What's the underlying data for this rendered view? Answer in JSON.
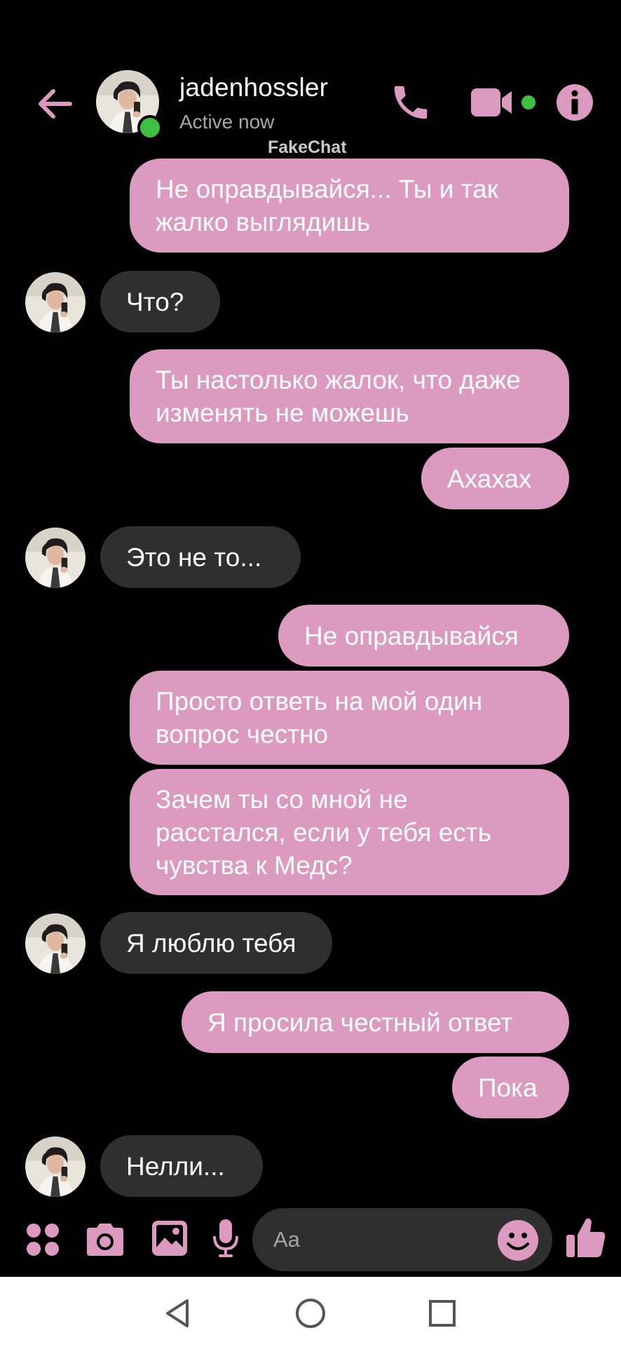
{
  "header": {
    "contact_name": "jadenhossler",
    "status": "Active now",
    "watermark": "FakeChat"
  },
  "messages": [
    {
      "side": "outgoing",
      "text": "Не оправдывайся... Ты и так жалко выглядишь"
    },
    {
      "side": "incoming",
      "text": "Что?"
    },
    {
      "side": "outgoing",
      "text": "Ты настолько жалок, что даже изменять не можешь"
    },
    {
      "side": "outgoing",
      "text": "Ахахах"
    },
    {
      "side": "incoming",
      "text": "Это не то..."
    },
    {
      "side": "outgoing",
      "text": "Не оправдывайся"
    },
    {
      "side": "outgoing",
      "text": "Просто ответь на мой один вопрос честно"
    },
    {
      "side": "outgoing",
      "text": "Зачем ты со мной не расстался, если у тебя есть чувства к Медс?"
    },
    {
      "side": "incoming",
      "text": "Я люблю тебя"
    },
    {
      "side": "outgoing",
      "text": "Я просила честный ответ"
    },
    {
      "side": "outgoing",
      "text": "Пока"
    },
    {
      "side": "incoming",
      "text": "Нелли..."
    }
  ],
  "composer": {
    "placeholder": "Aa",
    "icons": [
      "apps-icon",
      "camera-icon",
      "gallery-icon",
      "microphone-icon",
      "emoji-icon",
      "thumbs-up-icon"
    ]
  },
  "colors": {
    "accent": "#dd9ac0",
    "outgoing_bubble": "#dd9ac0",
    "incoming_bubble": "#2f2f2f",
    "background": "#000000",
    "online": "#3fbf3f"
  },
  "navbar": {
    "icons": [
      "back-nav-icon",
      "home-nav-icon",
      "recents-nav-icon"
    ]
  }
}
